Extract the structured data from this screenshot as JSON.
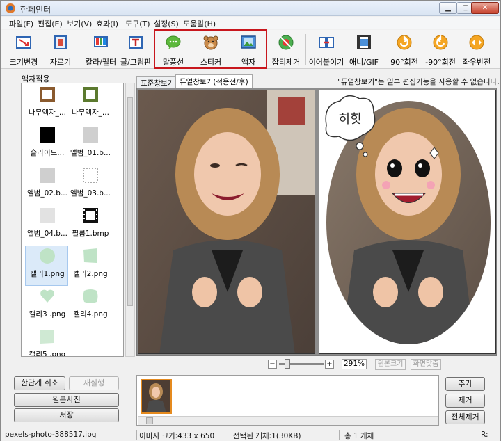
{
  "window": {
    "title": "한페인터"
  },
  "menu": [
    "파일(F)",
    "편집(E)",
    "보기(V)",
    "효과(I)",
    "도구(T)",
    "설정(S)",
    "도움말(H)"
  ],
  "toolbar": [
    {
      "label": "크기변경",
      "icon": "resize-icon"
    },
    {
      "label": "자르기",
      "icon": "crop-icon"
    },
    {
      "label": "칼라/필터",
      "icon": "color-filter-icon"
    },
    {
      "label": "글/그림판",
      "icon": "text-paint-icon"
    },
    {
      "label": "말풍선",
      "icon": "speech-bubble-icon"
    },
    {
      "label": "스티커",
      "icon": "sticker-icon"
    },
    {
      "label": "액자",
      "icon": "frame-icon"
    },
    {
      "label": "잡티제거",
      "icon": "blemish-remove-icon"
    },
    {
      "label": "이어붙이기",
      "icon": "merge-icon"
    },
    {
      "label": "애니/GIF",
      "icon": "gif-icon"
    },
    {
      "label": "90°회전",
      "icon": "rotate-cw-icon"
    },
    {
      "label": "-90°회전",
      "icon": "rotate-ccw-icon"
    },
    {
      "label": "좌우반전",
      "icon": "flip-icon"
    }
  ],
  "left_panel": {
    "title": "액자적용",
    "items": [
      {
        "label": "나무액자_..."
      },
      {
        "label": "나무액자_..."
      },
      {
        "label": "슬라이드..."
      },
      {
        "label": "앨범_01.b..."
      },
      {
        "label": "앨범_02.b..."
      },
      {
        "label": "앨범_03.b..."
      },
      {
        "label": "앨범_04.b..."
      },
      {
        "label": "필름1.bmp"
      },
      {
        "label": "캘리1.png"
      },
      {
        "label": "캘리2.png"
      },
      {
        "label": "캘리3 .png"
      },
      {
        "label": "캘리4.png"
      },
      {
        "label": "캘리5 .png"
      }
    ]
  },
  "tabs": {
    "standard": "표준창보기",
    "dual": "듀얼창보기(적용전/후)"
  },
  "notice": "\"듀얼창보기\"는 일부 편집기능을 사용할 수 없습니다.",
  "sticker_text": "히힛",
  "zoom": {
    "minus": "−",
    "plus": "+",
    "value": "291%",
    "original_size": "원본크기",
    "fit_screen": "화면맞춤"
  },
  "buttons": {
    "undo": "한단계 취소",
    "redo": "재실행",
    "original": "원본사진",
    "save": "저장",
    "add": "추가",
    "remove": "제거",
    "remove_all": "전체제거"
  },
  "status": {
    "filename": "pexels-photo-388517.jpg",
    "image_size": "이미지 크기:433 x 650",
    "selected": "선택된 개체:1(30KB)",
    "total": "총 1 개체",
    "mode": "R:"
  },
  "colors": {
    "highlight_border": "#c8171d",
    "selected_thumb": "#dbeaf9",
    "calli_green": "#bfe3c6"
  }
}
